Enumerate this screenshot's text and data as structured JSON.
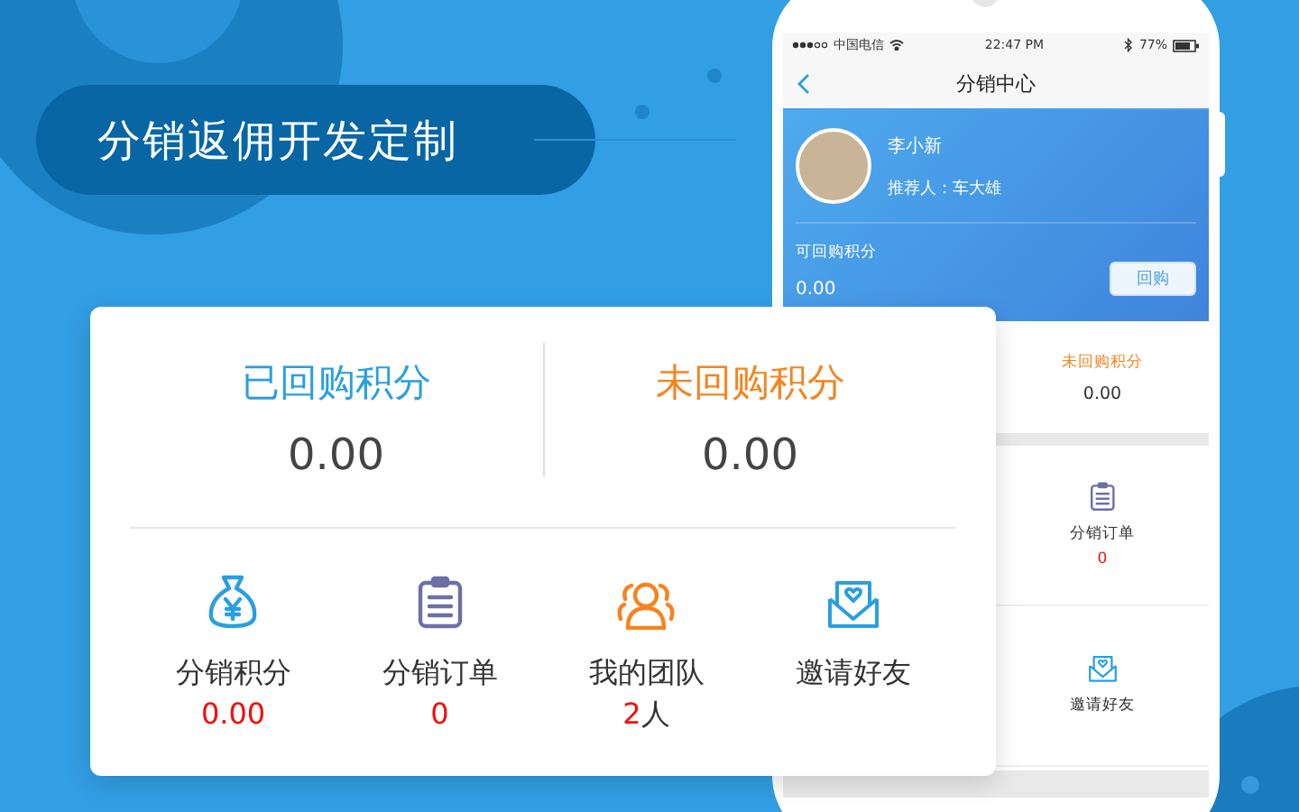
{
  "banner": {
    "title": "分销返佣开发定制"
  },
  "phone": {
    "status": {
      "carrier": "中国电信",
      "time": "22:47 PM",
      "battery": "77%"
    },
    "nav": {
      "title": "分销中心"
    },
    "profile": {
      "name": "李小新",
      "referrer": "推荐人：车大雄"
    },
    "balance": {
      "label": "可回购积分",
      "value": "0.00",
      "button": "回购"
    },
    "points": {
      "label": "未回购积分",
      "value": "0.00"
    },
    "menu": [
      {
        "label": "分销订单",
        "value": "0"
      },
      {
        "label": "邀请好友"
      }
    ]
  },
  "card": {
    "stats": [
      {
        "label": "已回购积分",
        "value": "0.00",
        "color": "#2a9fe0"
      },
      {
        "label": "未回购积分",
        "value": "0.00",
        "color": "#f5841f"
      }
    ],
    "menu": [
      {
        "label": "分销积分",
        "value": "0.00",
        "color": "#2a9fe0"
      },
      {
        "label": "分销订单",
        "value": "0",
        "color": "#6e6fa8"
      },
      {
        "label": "我的团队",
        "value": "2",
        "unit": "人",
        "color": "#f5841f"
      },
      {
        "label": "邀请好友",
        "color": "#2a9fe0"
      }
    ]
  }
}
